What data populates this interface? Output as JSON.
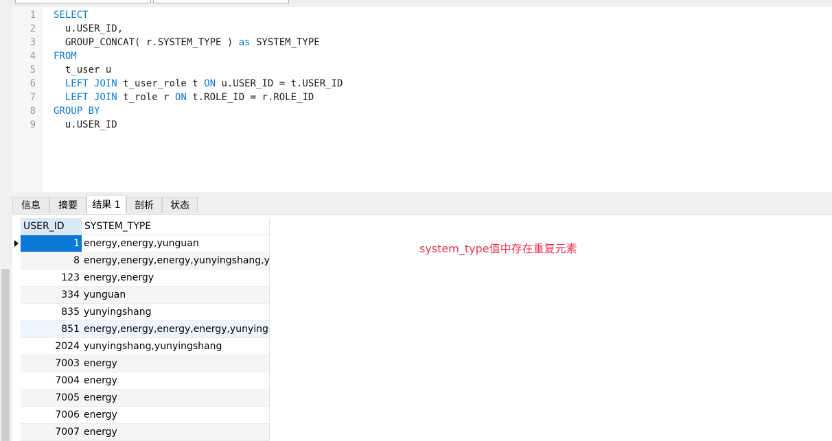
{
  "editor": {
    "line_numbers": [
      "1",
      "2",
      "3",
      "4",
      "5",
      "6",
      "7",
      "8",
      "9"
    ],
    "lines": [
      [
        {
          "t": "SELECT",
          "kw": true
        }
      ],
      [
        {
          "t": "  u.USER_ID,",
          "kw": false
        }
      ],
      [
        {
          "t": "  GROUP_CONCAT( r.SYSTEM_TYPE ) ",
          "kw": false
        },
        {
          "t": "as",
          "kw": true
        },
        {
          "t": " SYSTEM_TYPE",
          "kw": false
        }
      ],
      [
        {
          "t": "FROM",
          "kw": true
        }
      ],
      [
        {
          "t": "  t_user u",
          "kw": false
        }
      ],
      [
        {
          "t": "  ",
          "kw": false
        },
        {
          "t": "LEFT JOIN",
          "kw": true
        },
        {
          "t": " t_user_role t ",
          "kw": false
        },
        {
          "t": "ON",
          "kw": true
        },
        {
          "t": " u.USER_ID = t.USER_ID",
          "kw": false
        }
      ],
      [
        {
          "t": "  ",
          "kw": false
        },
        {
          "t": "LEFT JOIN",
          "kw": true
        },
        {
          "t": " t_role r ",
          "kw": false
        },
        {
          "t": "ON",
          "kw": true
        },
        {
          "t": " t.ROLE_ID = r.ROLE_ID",
          "kw": false
        }
      ],
      [
        {
          "t": "GROUP BY",
          "kw": true
        }
      ],
      [
        {
          "t": "  u.USER_ID",
          "kw": false
        }
      ]
    ]
  },
  "tabs": {
    "info": "信息",
    "summary": "摘要",
    "result1": "结果 1",
    "profile": "剖析",
    "status": "状态",
    "active": "result1"
  },
  "grid": {
    "columns": [
      "USER_ID",
      "SYSTEM_TYPE"
    ],
    "rows": [
      {
        "id": "1",
        "system_type": "energy,energy,yunguan"
      },
      {
        "id": "8",
        "system_type": "energy,energy,energy,yunyingshang,yunguan"
      },
      {
        "id": "123",
        "system_type": "energy,energy"
      },
      {
        "id": "334",
        "system_type": "yunguan"
      },
      {
        "id": "835",
        "system_type": "yunyingshang"
      },
      {
        "id": "851",
        "system_type": "energy,energy,energy,energy,yunyingshang"
      },
      {
        "id": "2024",
        "system_type": "yunyingshang,yunyingshang"
      },
      {
        "id": "7003",
        "system_type": "energy"
      },
      {
        "id": "7004",
        "system_type": "energy"
      },
      {
        "id": "7005",
        "system_type": "energy"
      },
      {
        "id": "7006",
        "system_type": "energy"
      },
      {
        "id": "7007",
        "system_type": "energy"
      }
    ],
    "selected_row": 0,
    "highlight_row": 5
  },
  "annotation": "system_type值中存在重复元素",
  "colors": {
    "keyword": "#0a7bd6",
    "selection": "#0a78d7",
    "annotation": "#e8364f"
  }
}
